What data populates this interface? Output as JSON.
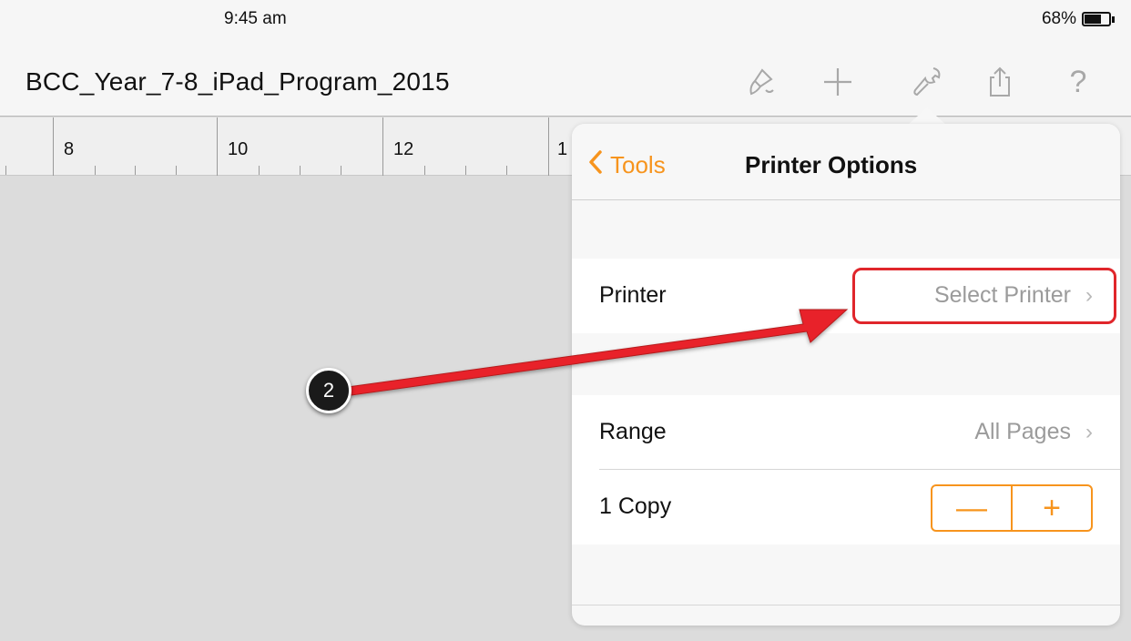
{
  "status_bar": {
    "time": "9:45 am",
    "battery": "68%",
    "battery_level": 0.68
  },
  "toolbar": {
    "document_title": "BCC_Year_7-8_iPad_Program_2015",
    "icons": [
      "paintbrush-icon",
      "plus-icon",
      "wrench-icon",
      "share-icon",
      "help-icon"
    ],
    "help_label": "?"
  },
  "ruler": {
    "labels": [
      "8",
      "10",
      "12",
      "1"
    ]
  },
  "popover": {
    "back_label": "Tools",
    "title": "Printer Options",
    "rows": {
      "printer": {
        "label": "Printer",
        "value": "Select Printer"
      },
      "range": {
        "label": "Range",
        "value": "All Pages"
      },
      "copies": {
        "label": "1 Copy",
        "minus": "—",
        "plus": "+"
      }
    }
  },
  "annotation": {
    "step": "2"
  },
  "colors": {
    "accent": "#f7941d",
    "highlight": "#e0262b",
    "background": "#dcdcdc"
  }
}
